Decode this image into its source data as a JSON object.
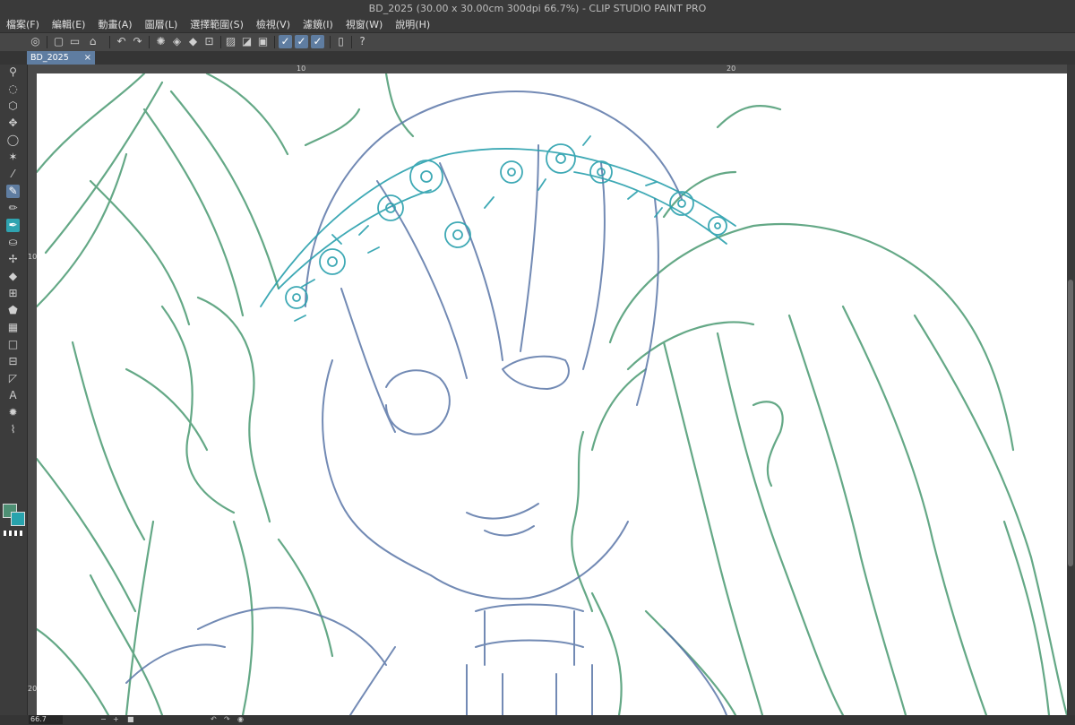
{
  "window": {
    "title": "BD_2025 (30.00 x 30.00cm 300dpi 66.7%)  - CLIP STUDIO PAINT PRO"
  },
  "menu": [
    "檔案(F)",
    "編輯(E)",
    "動畫(A)",
    "圖層(L)",
    "選擇範圍(S)",
    "檢視(V)",
    "濾鏡(I)",
    "視窗(W)",
    "說明(H)"
  ],
  "tab": {
    "name": "BD_2025",
    "close": "×"
  },
  "ruler": {
    "h": [
      "10",
      "20"
    ],
    "v": [
      "10",
      "20"
    ]
  },
  "status": {
    "zoom": "66.7"
  },
  "colors": {
    "main": "#4d8f73",
    "sub": "#28a3ad",
    "accent": "#5f7da1"
  },
  "icons": {
    "commands": [
      "clip-studio-icon",
      "new-file-icon",
      "open-file-icon",
      "save-icon",
      "undo-icon",
      "redo-icon",
      "clear-icon",
      "select-icon",
      "ruler-icon",
      "vector-icon",
      "pen-pressure-icon",
      "smartphone-icon",
      "help-icon"
    ],
    "tools": [
      "zoom-icon",
      "rotate-icon",
      "object-icon",
      "move-icon",
      "lasso-icon",
      "magic-wand-icon",
      "eyedropper-icon",
      "pen-icon",
      "pencil-icon",
      "brush-icon",
      "airbrush-icon",
      "decoration-icon",
      "eraser-icon",
      "blend-icon",
      "fill-icon",
      "gradient-icon",
      "figure-icon",
      "frame-icon",
      "ruler-tool-icon",
      "text-icon",
      "balloon-icon",
      "correct-line-icon"
    ]
  }
}
